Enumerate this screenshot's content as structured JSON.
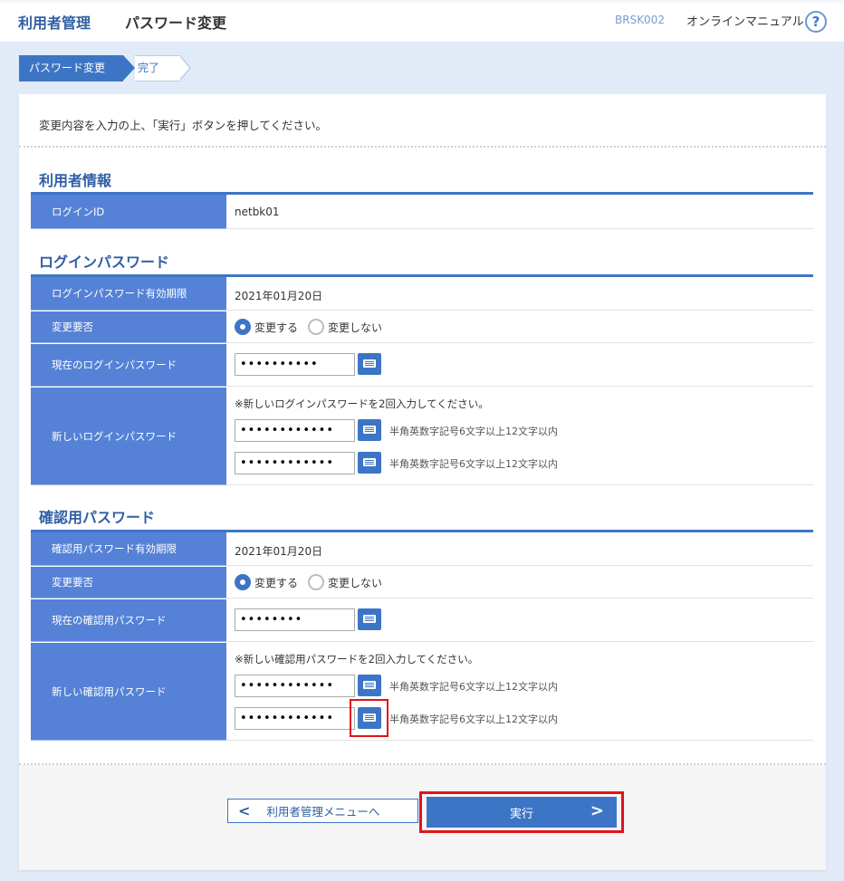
{
  "header": {
    "section": "利用者管理",
    "page_title": "パスワード変更",
    "screen_code": "BRSK002",
    "manual_link": "オンラインマニュアル",
    "help_icon": "?"
  },
  "steps": [
    {
      "label": "パスワード変更",
      "active": true
    },
    {
      "label": "完了",
      "active": false
    }
  ],
  "intro": "変更内容を入力の上、「実行」ボタンを押してください。",
  "user_info": {
    "title": "利用者情報",
    "login_id_label": "ログインID",
    "login_id_value": "netbk01"
  },
  "login_password": {
    "title": "ログインパスワード",
    "expiry_label": "ログインパスワード有効期限",
    "expiry_value": "2021年01月20日",
    "change_label": "変更要否",
    "radio_change": "変更する",
    "radio_nochange": "変更しない",
    "selected": "変更する",
    "current_label": "現在のログインパスワード",
    "current_value": "••••••••••",
    "new_label": "新しいログインパスワード",
    "new_note": "※新しいログインパスワードを2回入力してください。",
    "new_value_1": "••••••••••••",
    "new_value_2": "••••••••••••",
    "hint": "半角英数字記号6文字以上12文字以内"
  },
  "confirm_password": {
    "title": "確認用パスワード",
    "expiry_label": "確認用パスワード有効期限",
    "expiry_value": "2021年01月20日",
    "change_label": "変更要否",
    "radio_change": "変更する",
    "radio_nochange": "変更しない",
    "selected": "変更する",
    "current_label": "現在の確認用パスワード",
    "current_value": "••••••••",
    "new_label": "新しい確認用パスワード",
    "new_note": "※新しい確認用パスワードを2回入力してください。",
    "new_value_1": "••••••••••••",
    "new_value_2": "••••••••••••",
    "hint": "半角英数字記号6文字以上12文字以内"
  },
  "buttons": {
    "back": "利用者管理メニューへ",
    "back_icon": "chevron-left-icon",
    "execute": "実行",
    "execute_icon": "chevron-right-icon"
  },
  "colors": {
    "accent": "#3d75c6",
    "label_bg": "#5582d6",
    "highlight": "#e0141c",
    "page_bg": "#e1ebf7"
  }
}
